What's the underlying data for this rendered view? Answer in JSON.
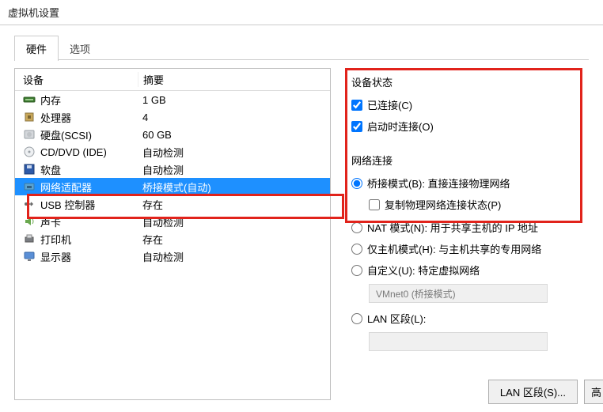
{
  "window": {
    "title": "虚拟机设置"
  },
  "tabs": {
    "hardware": "硬件",
    "options": "选项"
  },
  "list": {
    "header": {
      "device": "设备",
      "summary": "摘要"
    },
    "items": [
      {
        "icon": "memory-icon",
        "label": "内存",
        "summary": "1 GB"
      },
      {
        "icon": "cpu-icon",
        "label": "处理器",
        "summary": "4"
      },
      {
        "icon": "disk-icon",
        "label": "硬盘(SCSI)",
        "summary": "60 GB"
      },
      {
        "icon": "cd-icon",
        "label": "CD/DVD (IDE)",
        "summary": "自动检测"
      },
      {
        "icon": "floppy-icon",
        "label": "软盘",
        "summary": "自动检测"
      },
      {
        "icon": "nic-icon",
        "label": "网络适配器",
        "summary": "桥接模式(自动)"
      },
      {
        "icon": "usb-icon",
        "label": "USB 控制器",
        "summary": "存在"
      },
      {
        "icon": "sound-icon",
        "label": "声卡",
        "summary": "自动检测"
      },
      {
        "icon": "printer-icon",
        "label": "打印机",
        "summary": "存在"
      },
      {
        "icon": "display-icon",
        "label": "显示器",
        "summary": "自动检测"
      }
    ],
    "selected_index": 5
  },
  "right": {
    "device_state": {
      "title": "设备状态",
      "connected": "已连接(C)",
      "connect_at_power_on": "启动时连接(O)"
    },
    "network": {
      "title": "网络连接",
      "bridged": "桥接模式(B): 直接连接物理网络",
      "replicate": "复制物理网络连接状态(P)",
      "nat": "NAT 模式(N): 用于共享主机的 IP 地址",
      "hostonly": "仅主机模式(H): 与主机共享的专用网络",
      "custom": "自定义(U): 特定虚拟网络",
      "custom_value": "VMnet0 (桥接模式)",
      "lan_segment": "LAN 区段(L):"
    },
    "buttons": {
      "lan_segments": "LAN 区段(S)...",
      "advanced_cut": "高"
    }
  }
}
